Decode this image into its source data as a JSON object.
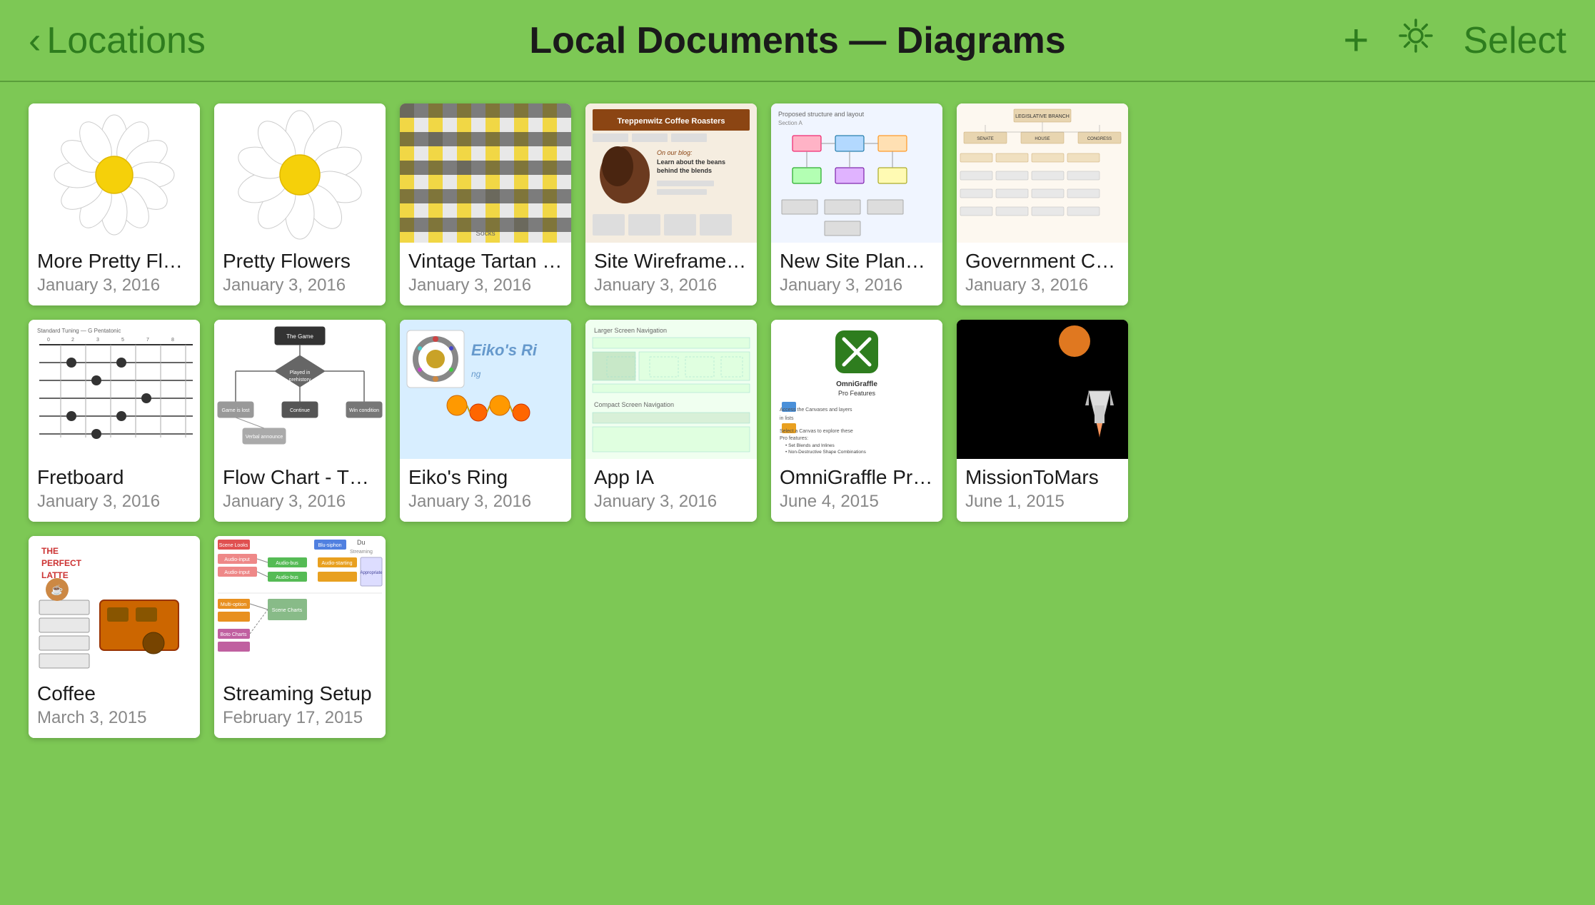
{
  "header": {
    "back_label": "Locations",
    "title": "Local Documents — Diagrams",
    "add_label": "+",
    "select_label": "Select"
  },
  "documents": [
    {
      "row": 0,
      "items": [
        {
          "id": "more-pretty-flowers",
          "title": "More Pretty Flowers",
          "date": "January 3, 2016",
          "thumb_type": "flower1"
        },
        {
          "id": "pretty-flowers",
          "title": "Pretty Flowers",
          "date": "January 3, 2016",
          "thumb_type": "flower2"
        },
        {
          "id": "vintage-tartan",
          "title": "Vintage Tartan Soc...",
          "date": "January 3, 2016",
          "thumb_type": "tartan"
        },
        {
          "id": "site-wireframe",
          "title": "Site Wireframe &...",
          "date": "January 3, 2016",
          "thumb_type": "wireframe"
        },
        {
          "id": "new-site-planning",
          "title": "New Site Planning",
          "date": "January 3, 2016",
          "thumb_type": "siteplanning"
        },
        {
          "id": "government-chart",
          "title": "Government Chart",
          "date": "January 3, 2016",
          "thumb_type": "govchart"
        }
      ]
    },
    {
      "row": 1,
      "items": [
        {
          "id": "fretboard",
          "title": "Fretboard",
          "date": "January 3, 2016",
          "thumb_type": "fretboard"
        },
        {
          "id": "flow-chart",
          "title": "Flow Chart - The G...",
          "date": "January 3, 2016",
          "thumb_type": "flowchart"
        },
        {
          "id": "eikos-ring",
          "title": "Eiko's Ring",
          "date": "January 3, 2016",
          "thumb_type": "eiko"
        },
        {
          "id": "app-ia",
          "title": "App IA",
          "date": "January 3, 2016",
          "thumb_type": "appia"
        },
        {
          "id": "omnigraffle-pro",
          "title": "OmniGraffle Pro Fe...",
          "date": "June 4, 2015",
          "thumb_type": "omni"
        },
        {
          "id": "mission-to-mars",
          "title": "MissionToMars",
          "date": "June 1, 2015",
          "thumb_type": "mars"
        }
      ]
    },
    {
      "row": 2,
      "items": [
        {
          "id": "coffee",
          "title": "Coffee",
          "date": "March 3, 2015",
          "thumb_type": "coffee"
        },
        {
          "id": "streaming-setup",
          "title": "Streaming Setup",
          "date": "February 17, 2015",
          "thumb_type": "streaming"
        }
      ]
    }
  ]
}
